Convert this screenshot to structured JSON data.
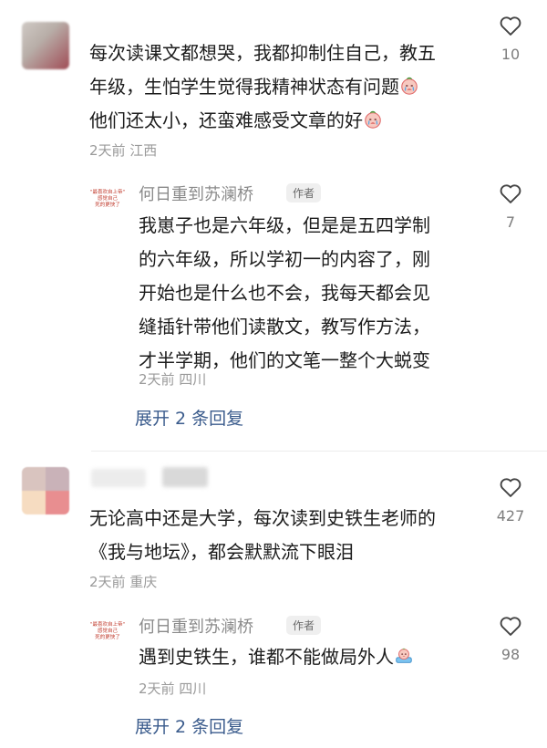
{
  "comment1": {
    "text_lines": [
      "每次读课文都想哭，我都抑制住自己，教五",
      "年级，生怕学生觉得我精神状态有问题",
      "他们还太小，还蛮难感受文章的好"
    ],
    "meta": "2天前 江西",
    "likes": "10",
    "reply": {
      "avatar_lines": [
        "\"最喜欢自上帝\"",
        "感觉自己",
        "死的更快了"
      ],
      "author": "何日重到苏澜桥",
      "badge": "作者",
      "text_lines": [
        "我崽子也是六年级，但是是五四学制",
        "的六年级，所以学初一的内容了，刚",
        "开始也是什么也不会，我每天都会见",
        "缝插针带他们读散文，教写作方法，",
        "才半学期，他们的文笔一整个大蜕变"
      ],
      "meta": "2天前 四川",
      "likes": "7"
    },
    "expand": "展开 2 条回复"
  },
  "comment2": {
    "text_lines": [
      "无论高中还是大学，每次读到史铁生老师的",
      "《我与地坛》，都会默默流下眼泪"
    ],
    "meta": "2天前 重庆",
    "likes": "427",
    "reply": {
      "avatar_lines": [
        "\"最喜欢自上帝\"",
        "感觉自己",
        "死的更快了"
      ],
      "author": "何日重到苏澜桥",
      "badge": "作者",
      "text_lines": [
        "遇到史铁生，谁都不能做局外人"
      ],
      "meta": "2天前 四川",
      "likes": "98"
    },
    "expand": "展开 2 条回复"
  }
}
